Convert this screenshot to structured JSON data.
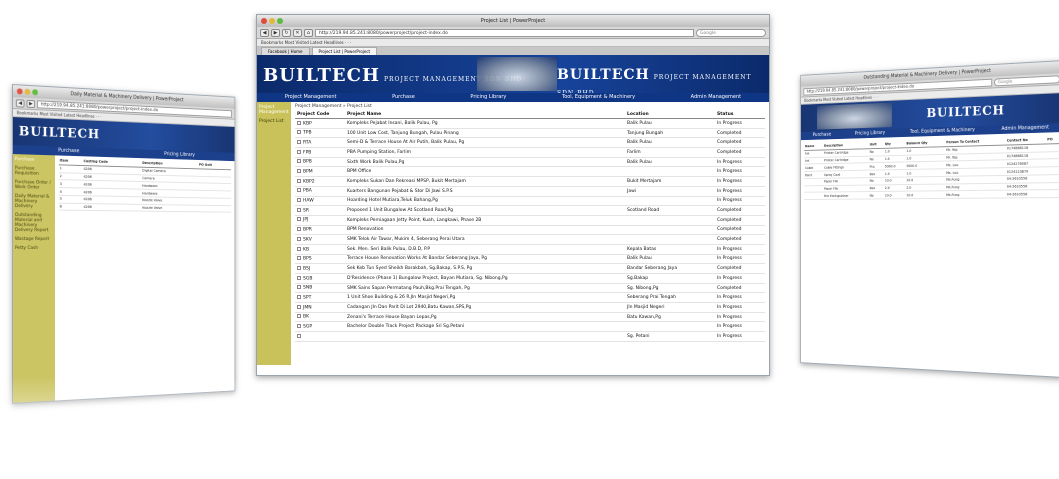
{
  "browser": {
    "window_title": "Project List | PowerProject",
    "url": "http://219.94.85.241:8080/powerproject/project-index.do",
    "search_placeholder": "Google",
    "bookmarks": "Bookmarks  Most Visited  Latest Headlines  ·  ·  ·",
    "tabs": [
      "Facebook | Home",
      "Project List | PowerProject"
    ]
  },
  "app": {
    "brand": "BUILTECH",
    "brand_sub": "PROJECT MANAGEMENT SDN BHD",
    "menu": [
      "Project Management",
      "Purchase",
      "Pricing Library",
      "Tool, Equipment & Machinery",
      "Admin Management"
    ],
    "sidebar": [
      "Project Management",
      "Project List"
    ],
    "breadcrumb": "Project Management » Project List"
  },
  "project_table": {
    "headers": [
      "Project Code",
      "Project Name",
      "Location",
      "Status"
    ],
    "rows": [
      [
        "KBP",
        "Kompleks Pejabat Insani, Balik Pulau, Pg",
        "Balik Pulau",
        "In Progress"
      ],
      [
        "TPB",
        "100 Unit Low Cost, Tanjung Bungah, Pulau Pinang",
        "Tanjung Bungah",
        "Completed"
      ],
      [
        "RTA",
        "Semi-D & Terrace House At Air Putih, Balik Pulau, Pg",
        "Balik Pulau",
        "Completed"
      ],
      [
        "FPB",
        "PBA Pumping Station, Farlim",
        "Farlim",
        "Completed"
      ],
      [
        "BPB",
        "Sixth Work Balik Pulau,Pg",
        "Balik Pulau",
        "In Progress"
      ],
      [
        "BPM",
        "BPM Office",
        "",
        "In Progress"
      ],
      [
        "KBP2",
        "Kompleks Sukan Dan Rekreasi MPSP, Bukit Mertajam",
        "Bukit Mertajam",
        "In Progress"
      ],
      [
        "PBA",
        "Kuarters Bangunan Pejabat & Stor Di Jawi S.P.S",
        "Jawi",
        "In Progress"
      ],
      [
        "HAW",
        "Hoarding Hotel Mutiara,Teluk Bahang,Pg",
        "",
        "In Progress"
      ],
      [
        "SR",
        "Proposed 1 Unit Bungalow At Scotland Road,Pg",
        "Scotland Road",
        "Completed"
      ],
      [
        "JPJ",
        "Kompleks Perniagaan Jetty Point, Kuah, Langkawi, Phase 2B",
        "",
        "Completed"
      ],
      [
        "BPR",
        "BPM Renovation",
        "",
        "Completed"
      ],
      [
        "SKV",
        "SMK Telok Air Tawar, Mukim 4, Seberang Perai Utara",
        "",
        "Completed"
      ],
      [
        "KB",
        "Sek. Men. Seri Balik Pulau, D.B.D, P.P",
        "Kepala Batas",
        "In Progress"
      ],
      [
        "BPS",
        "Terrace House Renovation Works At Bandar Seberang Jaya, Pg",
        "Balik Pulau",
        "In Progress"
      ],
      [
        "BSJ",
        "Sek Keb Tun Syed Sheikh Barakbah, Sg.Bakap, S.P.S, Pg",
        "Bandar Seberang Jaya",
        "Completed"
      ],
      [
        "SGB",
        "D'Residence (Phase 1) Bungalow Project, Bayan Mutiara, Sg. Nibong,Pg",
        "Sg.Bakap",
        "In Progress"
      ],
      [
        "SNB",
        "SMK Sains Sapan Permatang Pauh,Bkg.Prai Tengah, Pg",
        "Sg. Nibong,Pg",
        "Completed"
      ],
      [
        "SPT",
        "1 Unit Shoe Building & 26 R.Jln Masjid Negeri,Pg",
        "Seberang Prai Tengah",
        "In Progress"
      ],
      [
        "JMN",
        "Cadangan Jln Dan Parit Di Lot 2940,Batu Kawan,SPS,Pg",
        "Jln Masjid Negeri",
        "In Progress"
      ],
      [
        "BK",
        "Zenani's Terrace House Bayan Lepas,Pg",
        "Batu Kawan,Pg",
        "In Progress"
      ],
      [
        "SGP",
        "Bachelor Double Track Project Package Sri Sg.Petani",
        "",
        "In Progress"
      ],
      [
        "",
        "",
        "Sg. Petani",
        "In Progress"
      ]
    ]
  },
  "left_window": {
    "title": "Daily Material & Machinery Delivery | PowerProject",
    "side": [
      "Purchase",
      "Purchase Requisition",
      "Purchase Order / Work Order",
      "Daily Material & Machinery Delivery",
      "Outstanding Material and Machinery Delivery Report",
      "Wastage Report",
      "Petty Cash"
    ],
    "headers": [
      "Item",
      "Costing Code",
      "Description",
      "PO Unit"
    ],
    "rows": [
      [
        "1",
        "4206",
        "Digital Camera",
        ""
      ],
      [
        "2",
        "4206",
        "Camera",
        ""
      ],
      [
        "3",
        "4206",
        "Hardware",
        ""
      ],
      [
        "4",
        "4206",
        "Hardware",
        ""
      ],
      [
        "5",
        "4206",
        "Nozzle Valve",
        ""
      ],
      [
        "6",
        "4206",
        "Nozzle Valve",
        ""
      ]
    ]
  },
  "right_window": {
    "title": "Outstanding Material & Machinery Delivery | PowerProject",
    "headers": [
      "Name",
      "Description",
      "Unit",
      "Qty",
      "Balance Qty",
      "Person To Contact",
      "Contact No",
      "PO"
    ],
    "rows": [
      [
        "Ink",
        "Printer Cartridge",
        "No",
        "1.0",
        "1.0",
        "Mr. Yap",
        "0174868118",
        ""
      ],
      [
        "Ink",
        "Printer Cartridge",
        "No",
        "1.0",
        "1.0",
        "Mr. Yap",
        "0174868118",
        ""
      ],
      [
        "Cable",
        "Cable Fittings",
        "Pcs",
        "5000.0",
        "5000.0",
        "Ms. Lou",
        "0124276087",
        ""
      ],
      [
        "Paint",
        "Spray Coat",
        "Box",
        "1.0",
        "1.0",
        "Ms. Lou",
        "0124123879",
        ""
      ],
      [
        "",
        "Paper File",
        "No",
        "10.0",
        "10.0",
        "Ms.Fung",
        "04-2610556",
        ""
      ],
      [
        "",
        "Paper File",
        "Box",
        "2.0",
        "2.0",
        "Ms.Fung",
        "04-2610556",
        ""
      ],
      [
        "",
        "Fire Extinguisher",
        "No",
        "10.0",
        "10.0",
        "Ms.Fung",
        "04-2610556",
        ""
      ]
    ]
  },
  "colors": {
    "banner": "#0b2a6b",
    "sidebar": "#c9c25a",
    "menubar": "#0f3585"
  }
}
